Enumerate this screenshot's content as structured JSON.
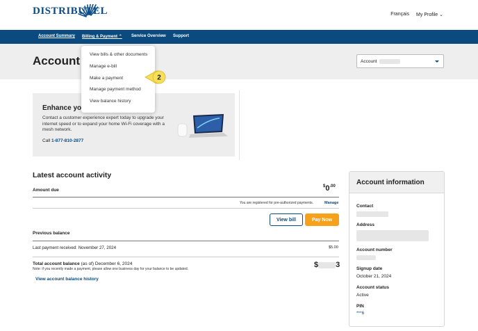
{
  "brand": {
    "logo_text": "DISTRIBUTEL",
    "color": "#0b4a7e"
  },
  "top_links": {
    "language": "Français",
    "profile": "My Profile"
  },
  "nav": [
    {
      "label": "Account Summary"
    },
    {
      "label": "Billing & Payment"
    },
    {
      "label": "Service Overview"
    },
    {
      "label": "Support"
    }
  ],
  "billing_menu": [
    {
      "label": "View bills & other documents"
    },
    {
      "label": "Manage e-bill"
    },
    {
      "label": "Make a payment"
    },
    {
      "label": "Manage payment method"
    },
    {
      "label": "View balance history"
    }
  ],
  "callout_number": "2",
  "page_title": "Account su",
  "account_select": {
    "label": "Account"
  },
  "promo": {
    "title": "Enhance you",
    "body": "Contact a customer experience expert today to upgrade your internet speed or to expand your home Wi-Fi coverage with a mesh network.",
    "call_prefix": "Call",
    "phone": "1-877-810-2877"
  },
  "activity": {
    "title": "Latest account activity",
    "amount_due_label": "Amount due",
    "amount_due_dollar": "$",
    "amount_due_whole": "0",
    "amount_due_cents": ".00",
    "preauth_text": "You are registered for pre-authorized payments.",
    "manage_label": "Manage",
    "view_bill_label": "View bill",
    "pay_now_label": "Pay Now",
    "previous_balance_label": "Previous balance",
    "last_payment_text": "Last payment received: November 27, 2024",
    "last_payment_amount": "$5.00",
    "total_balance_label": "Total account balance",
    "total_balance_date": "(as of) December 6, 2024",
    "total_balance_note": "Note: if you recently made a payment, please allow one business day for your balance to be updated.",
    "total_prefix": "$",
    "total_suffix": "3",
    "history_link": "View account balance history"
  },
  "account_info": {
    "title": "Account information",
    "contact_label": "Contact",
    "address_label": "Address",
    "account_number_label": "Account number",
    "signup_label": "Signup date",
    "signup_value": "October 21, 2024",
    "status_label": "Account status",
    "status_value": "Active",
    "pin_label": "PIN",
    "pin_value": "***6"
  }
}
